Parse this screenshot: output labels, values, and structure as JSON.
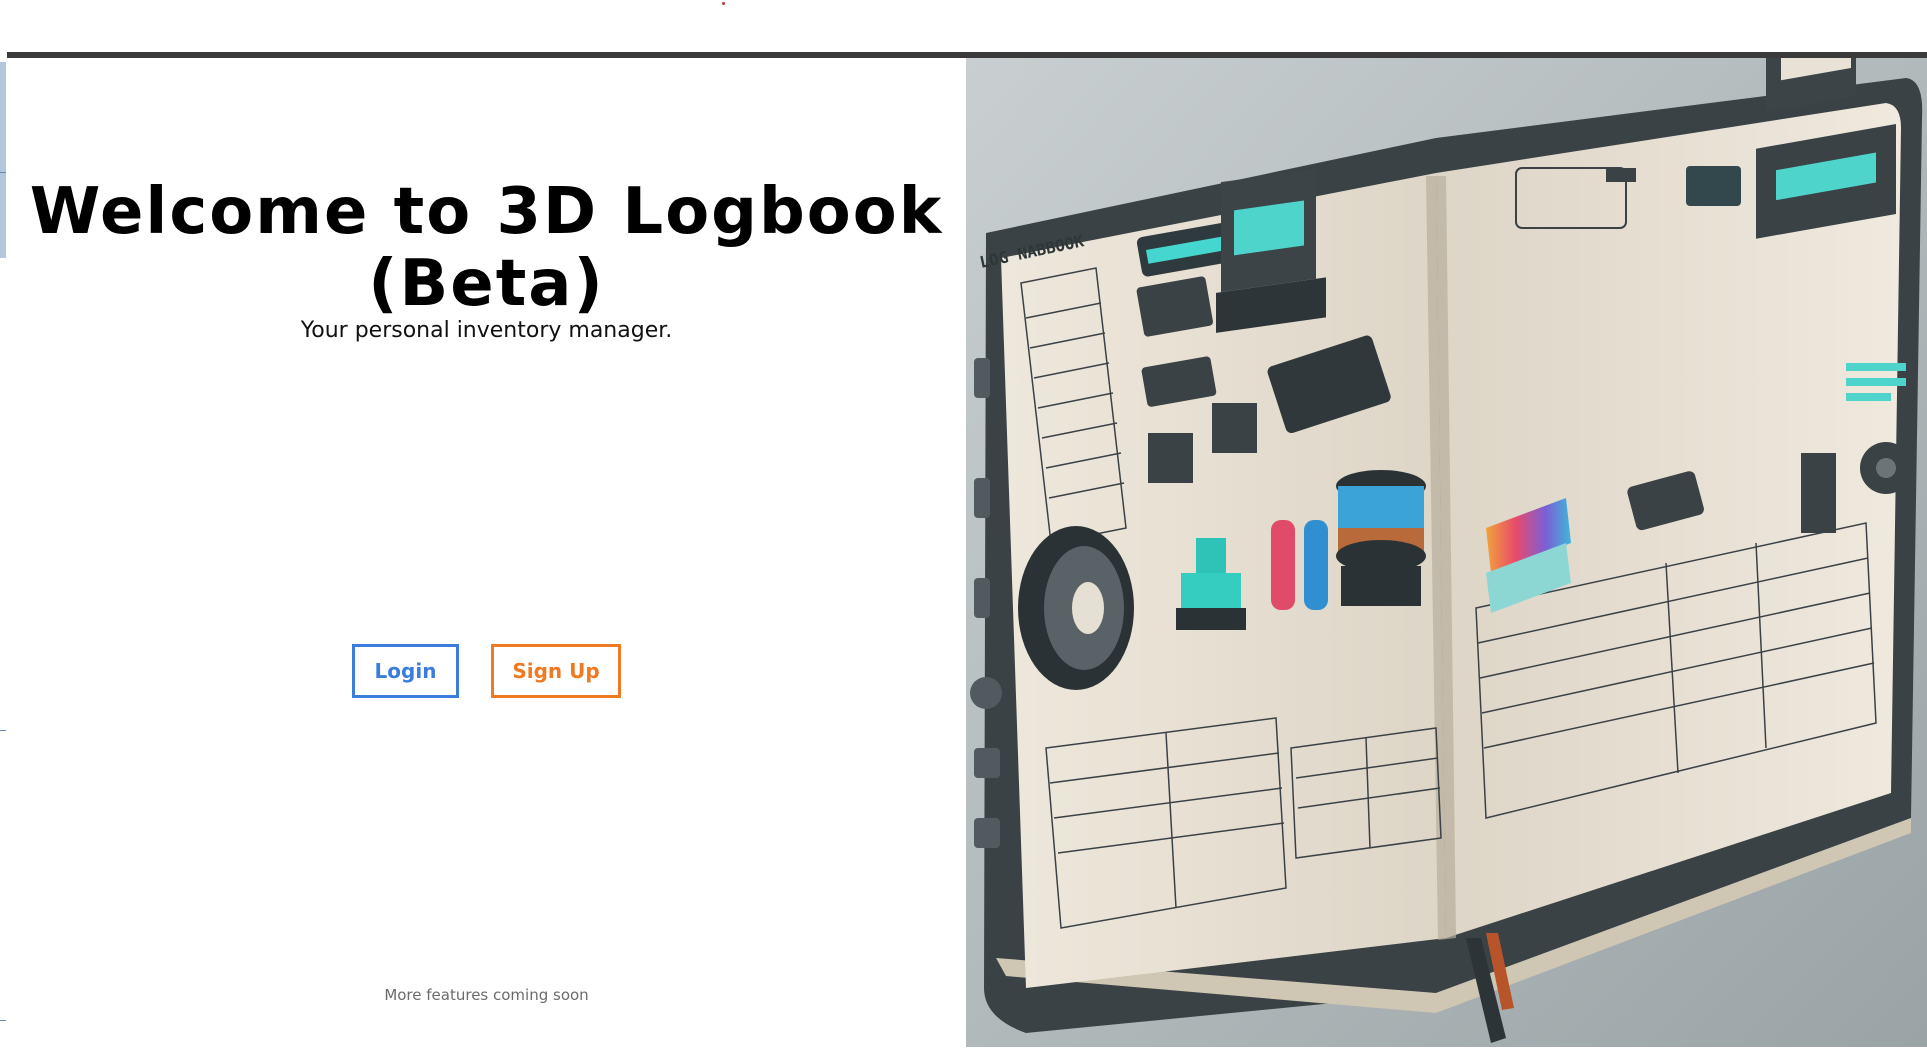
{
  "hero": {
    "title": "Welcome to 3D Logbook (Beta)",
    "subtitle": "Your personal inventory manager."
  },
  "actions": {
    "login_label": "Login",
    "signup_label": "Sign Up"
  },
  "footer": {
    "note": "More features coming soon"
  },
  "illustration": {
    "book_heading": "LOG NABBOOK"
  },
  "colors": {
    "login_accent": "#3b7ddd",
    "signup_accent": "#ef7a21"
  }
}
